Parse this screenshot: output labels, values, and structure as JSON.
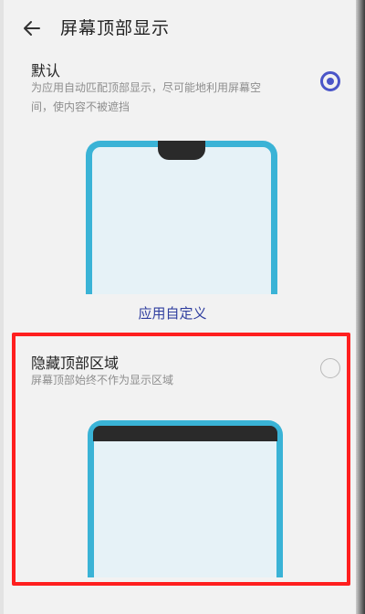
{
  "header": {
    "title": "屏幕顶部显示",
    "back_icon": "arrow-left-icon"
  },
  "options": [
    {
      "title": "默认",
      "description_line1": "为应用自动匹配顶部显示，尽可能地利用屏幕空",
      "description_line2": "间，使内容不被遮挡",
      "selected": true
    },
    {
      "title": "隐藏顶部区域",
      "description": "屏幕顶部始终不作为显示区域",
      "selected": false
    }
  ],
  "app_custom_label": "应用自定义",
  "colors": {
    "accent": "#4a55c8",
    "link": "#2f3e9f",
    "phone_frame": "#3ab3d6",
    "highlight_box": "#ff1f1f"
  }
}
